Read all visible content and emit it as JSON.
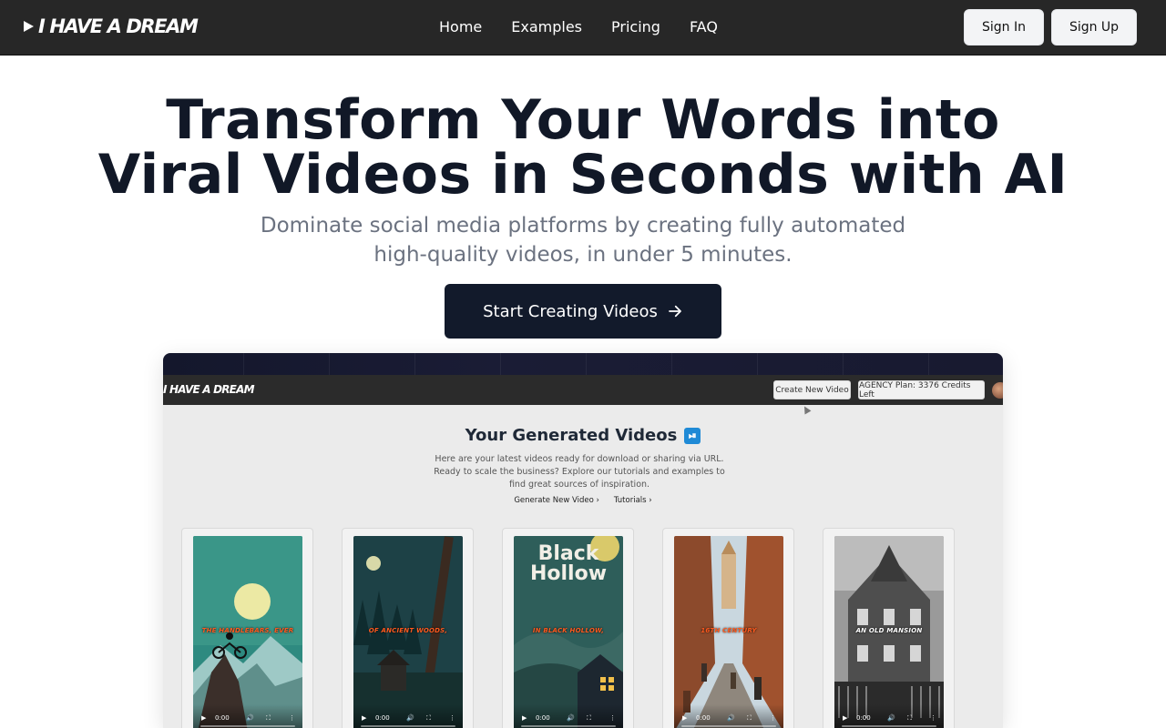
{
  "nav": {
    "logo_text": "I HAVE A DREAM",
    "links": [
      "Home",
      "Examples",
      "Pricing",
      "FAQ"
    ],
    "sign_in": "Sign In",
    "sign_up": "Sign Up"
  },
  "hero": {
    "title_line1": "Transform Your Words into",
    "title_line2": "Viral Videos in Seconds with AI",
    "subtitle_line1": "Dominate social media platforms by creating fully automated",
    "subtitle_line2": "high-quality videos, in under 5 minutes.",
    "cta": "Start Creating Videos"
  },
  "preview": {
    "logo_text": "I HAVE A DREAM",
    "create_button": "Create New Video",
    "plan_button": "AGENCY Plan: 3376 Credits Left",
    "heading": "Your Generated Videos",
    "heading_icon": "play-pause-icon",
    "description": "Here are your latest videos ready for download or sharing via URL. Ready to scale the business? Explore our tutorials and examples to find great sources of inspiration.",
    "links": [
      "Generate New Video ›",
      "Tutorials ›"
    ],
    "videos": [
      {
        "caption": "THE HANDLEBARS, EVER",
        "time": "0:00"
      },
      {
        "caption": "OF ANCIENT WOODS,",
        "time": "0:00"
      },
      {
        "title": "Black Hollow",
        "caption": "IN BLACK HOLLOW,",
        "time": "0:00"
      },
      {
        "caption": "16TH CENTURY",
        "time": "0:00"
      },
      {
        "caption": "AN OLD MANSION",
        "time": "0:00"
      }
    ]
  },
  "colors": {
    "nav_bg": "#272727",
    "cta_bg": "#121a2b",
    "title": "#111827",
    "subtitle": "#6b7280",
    "caption_orange": "#ff5a1f"
  }
}
